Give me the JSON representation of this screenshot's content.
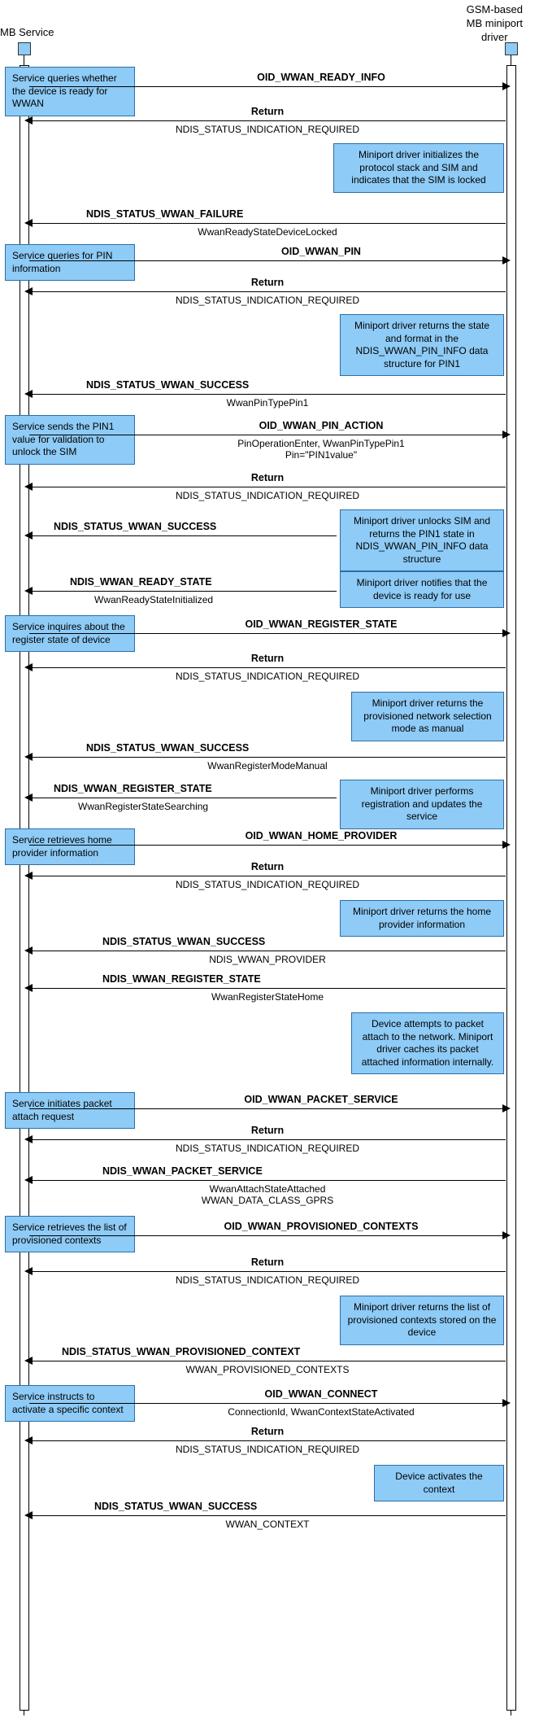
{
  "actors": {
    "left": "MB Service",
    "right": "GSM-based\nMB miniport\ndriver"
  },
  "leftNotes": [
    "Service queries whether the device is ready for WWAN",
    "Service queries for PIN information",
    "Service sends the PIN1 value for validation to unlock the SIM",
    "Service inquires about the register state of device",
    "Service retrieves home provider information",
    "Service initiates packet attach request",
    "Service retrieves the list of provisioned contexts",
    "Service instructs to activate a specific context"
  ],
  "rightNotes": [
    "Miniport driver initializes the protocol stack and SIM and indicates that the SIM is locked",
    "Miniport driver returns the state and format in the NDIS_WWAN_PIN_INFO data structure for PIN1",
    "Miniport driver unlocks SIM and returns the PIN1 state in  NDIS_WWAN_PIN_INFO data structure",
    "Miniport driver notifies that the device is ready for use",
    "Miniport driver returns the provisioned network selection mode as manual",
    "Miniport driver performs registration and updates the service",
    "Miniport driver returns the home provider information",
    "Device attempts to packet attach to the network. Miniport driver caches its packet attached information internally.",
    "Miniport driver returns the list of provisioned contexts stored on the device",
    "Device activates the context"
  ],
  "messages": {
    "m1": {
      "label": "OID_WWAN_READY_INFO",
      "sub": ""
    },
    "m2": {
      "label": "Return",
      "sub": "NDIS_STATUS_INDICATION_REQUIRED"
    },
    "m3": {
      "label": "NDIS_STATUS_WWAN_FAILURE",
      "sub": "WwanReadyStateDeviceLocked"
    },
    "m4": {
      "label": "OID_WWAN_PIN",
      "sub": ""
    },
    "m5": {
      "label": "Return",
      "sub": "NDIS_STATUS_INDICATION_REQUIRED"
    },
    "m6": {
      "label": "NDIS_STATUS_WWAN_SUCCESS",
      "sub": "WwanPinTypePin1"
    },
    "m7": {
      "label": "OID_WWAN_PIN_ACTION",
      "sub": "PinOperationEnter, WwanPinTypePin1\nPin=\"PIN1value\""
    },
    "m8": {
      "label": "Return",
      "sub": "NDIS_STATUS_INDICATION_REQUIRED"
    },
    "m9": {
      "label": "NDIS_STATUS_WWAN_SUCCESS",
      "sub": ""
    },
    "m10": {
      "label": "NDIS_WWAN_READY_STATE",
      "sub": "WwanReadyStateInitialized"
    },
    "m11": {
      "label": "OID_WWAN_REGISTER_STATE",
      "sub": ""
    },
    "m12": {
      "label": "Return",
      "sub": "NDIS_STATUS_INDICATION_REQUIRED"
    },
    "m13": {
      "label": "NDIS_STATUS_WWAN_SUCCESS",
      "sub": "WwanRegisterModeManual"
    },
    "m14": {
      "label": "NDIS_WWAN_REGISTER_STATE",
      "sub": "WwanRegisterStateSearching"
    },
    "m15": {
      "label": "OID_WWAN_HOME_PROVIDER",
      "sub": ""
    },
    "m16": {
      "label": "Return",
      "sub": "NDIS_STATUS_INDICATION_REQUIRED"
    },
    "m17": {
      "label": "NDIS_STATUS_WWAN_SUCCESS",
      "sub": "NDIS_WWAN_PROVIDER"
    },
    "m18": {
      "label": "NDIS_WWAN_REGISTER_STATE",
      "sub": "WwanRegisterStateHome"
    },
    "m19": {
      "label": "OID_WWAN_PACKET_SERVICE",
      "sub": ""
    },
    "m20": {
      "label": "Return",
      "sub": "NDIS_STATUS_INDICATION_REQUIRED"
    },
    "m21": {
      "label": "NDIS_WWAN_PACKET_SERVICE",
      "sub": "WwanAttachStateAttached\nWWAN_DATA_CLASS_GPRS"
    },
    "m22": {
      "label": "OID_WWAN_PROVISIONED_CONTEXTS",
      "sub": ""
    },
    "m23": {
      "label": "Return",
      "sub": "NDIS_STATUS_INDICATION_REQUIRED"
    },
    "m24": {
      "label": "NDIS_STATUS_WWAN_PROVISIONED_CONTEXT",
      "sub": "WWAN_PROVISIONED_CONTEXTS"
    },
    "m25": {
      "label": "OID_WWAN_CONNECT",
      "sub": "ConnectionId, WwanContextStateActivated"
    },
    "m26": {
      "label": "Return",
      "sub": "NDIS_STATUS_INDICATION_REQUIRED"
    },
    "m27": {
      "label": "NDIS_STATUS_WWAN_SUCCESS",
      "sub": "WWAN_CONTEXT"
    }
  }
}
